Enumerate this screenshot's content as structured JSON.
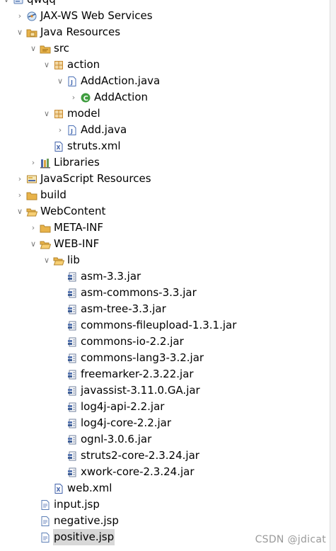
{
  "tree": {
    "rows": [
      {
        "label": "qwqq",
        "depth": 0,
        "expand": "open",
        "icon": "project-icon"
      },
      {
        "label": "JAX-WS Web Services",
        "depth": 1,
        "expand": "closed",
        "icon": "web-services-icon"
      },
      {
        "label": "Java Resources",
        "depth": 1,
        "expand": "open",
        "icon": "java-resources-icon"
      },
      {
        "label": "src",
        "depth": 2,
        "expand": "open",
        "icon": "source-folder-icon"
      },
      {
        "label": "action",
        "depth": 3,
        "expand": "open",
        "icon": "package-icon"
      },
      {
        "label": "AddAction.java",
        "depth": 4,
        "expand": "open",
        "icon": "java-file-icon"
      },
      {
        "label": "AddAction",
        "depth": 5,
        "expand": "closed",
        "icon": "class-icon"
      },
      {
        "label": "model",
        "depth": 3,
        "expand": "open",
        "icon": "package-icon"
      },
      {
        "label": "Add.java",
        "depth": 4,
        "expand": "closed",
        "icon": "java-file-icon"
      },
      {
        "label": "struts.xml",
        "depth": 3,
        "expand": "none",
        "icon": "xml-file-icon"
      },
      {
        "label": "Libraries",
        "depth": 2,
        "expand": "closed",
        "icon": "libraries-icon"
      },
      {
        "label": "JavaScript Resources",
        "depth": 1,
        "expand": "closed",
        "icon": "javascript-resources-icon"
      },
      {
        "label": "build",
        "depth": 1,
        "expand": "closed",
        "icon": "folder-icon"
      },
      {
        "label": "WebContent",
        "depth": 1,
        "expand": "open",
        "icon": "folder-open-icon"
      },
      {
        "label": "META-INF",
        "depth": 2,
        "expand": "closed",
        "icon": "folder-icon"
      },
      {
        "label": "WEB-INF",
        "depth": 2,
        "expand": "open",
        "icon": "folder-open-icon"
      },
      {
        "label": "lib",
        "depth": 3,
        "expand": "open",
        "icon": "folder-open-icon"
      },
      {
        "label": "asm-3.3.jar",
        "depth": 4,
        "expand": "none",
        "icon": "jar-icon"
      },
      {
        "label": "asm-commons-3.3.jar",
        "depth": 4,
        "expand": "none",
        "icon": "jar-icon"
      },
      {
        "label": "asm-tree-3.3.jar",
        "depth": 4,
        "expand": "none",
        "icon": "jar-icon"
      },
      {
        "label": "commons-fileupload-1.3.1.jar",
        "depth": 4,
        "expand": "none",
        "icon": "jar-icon"
      },
      {
        "label": "commons-io-2.2.jar",
        "depth": 4,
        "expand": "none",
        "icon": "jar-icon"
      },
      {
        "label": "commons-lang3-3.2.jar",
        "depth": 4,
        "expand": "none",
        "icon": "jar-icon"
      },
      {
        "label": "freemarker-2.3.22.jar",
        "depth": 4,
        "expand": "none",
        "icon": "jar-icon"
      },
      {
        "label": "javassist-3.11.0.GA.jar",
        "depth": 4,
        "expand": "none",
        "icon": "jar-icon"
      },
      {
        "label": "log4j-api-2.2.jar",
        "depth": 4,
        "expand": "none",
        "icon": "jar-icon"
      },
      {
        "label": "log4j-core-2.2.jar",
        "depth": 4,
        "expand": "none",
        "icon": "jar-icon"
      },
      {
        "label": "ognl-3.0.6.jar",
        "depth": 4,
        "expand": "none",
        "icon": "jar-icon"
      },
      {
        "label": "struts2-core-2.3.24.jar",
        "depth": 4,
        "expand": "none",
        "icon": "jar-icon"
      },
      {
        "label": "xwork-core-2.3.24.jar",
        "depth": 4,
        "expand": "none",
        "icon": "jar-icon"
      },
      {
        "label": "web.xml",
        "depth": 3,
        "expand": "none",
        "icon": "xml-file-icon"
      },
      {
        "label": "input.jsp",
        "depth": 2,
        "expand": "none",
        "icon": "jsp-file-icon"
      },
      {
        "label": "negative.jsp",
        "depth": 2,
        "expand": "none",
        "icon": "jsp-file-icon"
      },
      {
        "label": "positive.jsp",
        "depth": 2,
        "expand": "none",
        "icon": "jsp-file-icon",
        "selected": true
      }
    ]
  },
  "watermark": "CSDN @jdicat",
  "colors": {
    "selection": "#d8d8d8",
    "folder": "#e8b34a",
    "package": "#c98a2e",
    "class": "#3f9d3f",
    "java_file": "#4a6fb5",
    "jar": "#6f7f9c",
    "xml": "#3e5fa8"
  }
}
